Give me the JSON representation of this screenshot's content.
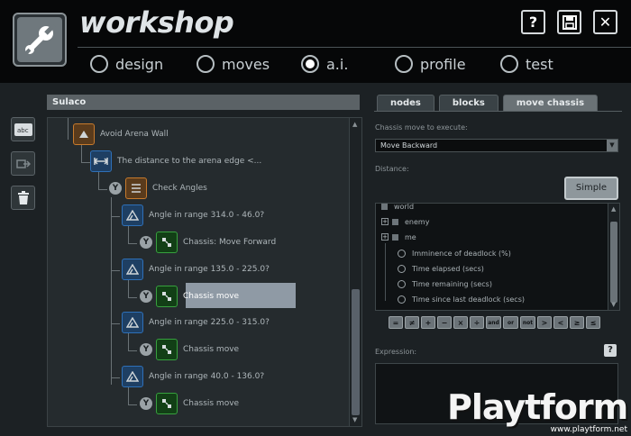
{
  "app": {
    "title": "workshop"
  },
  "window_buttons": {
    "help": "?",
    "close": "✕"
  },
  "nav": [
    {
      "label": "design",
      "selected": false
    },
    {
      "label": "moves",
      "selected": false
    },
    {
      "label": "a.i.",
      "selected": true
    },
    {
      "label": "profile",
      "selected": false
    },
    {
      "label": "test",
      "selected": false
    }
  ],
  "tree": {
    "title": "Sulaco",
    "yes_marker": "Y",
    "nodes": {
      "avoid_wall": "Avoid Arena Wall",
      "distance": "The distance to the arena edge <...",
      "check_angles": "Check Angles",
      "angle1": "Angle in range 314.0 - 46.0?",
      "action1": "Chassis: Move Forward",
      "angle2": "Angle in range 135.0 - 225.0?",
      "action2": "Chassis move",
      "angle3": "Angle in range 225.0 - 315.0?",
      "action3": "Chassis move",
      "angle4": "Angle in range 40.0 - 136.0?",
      "action4": "Chassis move"
    }
  },
  "tabs": [
    {
      "label": "nodes",
      "active": false
    },
    {
      "label": "blocks",
      "active": false
    },
    {
      "label": "move chassis",
      "active": true
    }
  ],
  "chassis": {
    "label": "Chassis move to execute:",
    "selected": "Move Backward",
    "distance_label": "Distance:",
    "simple_button": "Simple",
    "variables": {
      "world": "world",
      "enemy": "enemy",
      "me": "me",
      "imminence": "Imminence of deadlock (%)",
      "elapsed": "Time elapsed (secs)",
      "remaining": "Time remaining (secs)",
      "since": "Time since last deadlock (secs)"
    },
    "operators": [
      "=",
      "≠",
      "+",
      "−",
      "×",
      "÷",
      "and",
      "or",
      "not",
      ">",
      "<",
      "≥",
      "≤"
    ],
    "expression_label": "Expression:",
    "expression_help": "?"
  },
  "watermark": {
    "brand": "Playtform",
    "url": "www.playtform.net"
  },
  "colors": {
    "accent_blue": "#2e70b8",
    "accent_orange": "#c77a2c",
    "accent_green": "#37a13e",
    "selection": "#8f9aa5"
  }
}
